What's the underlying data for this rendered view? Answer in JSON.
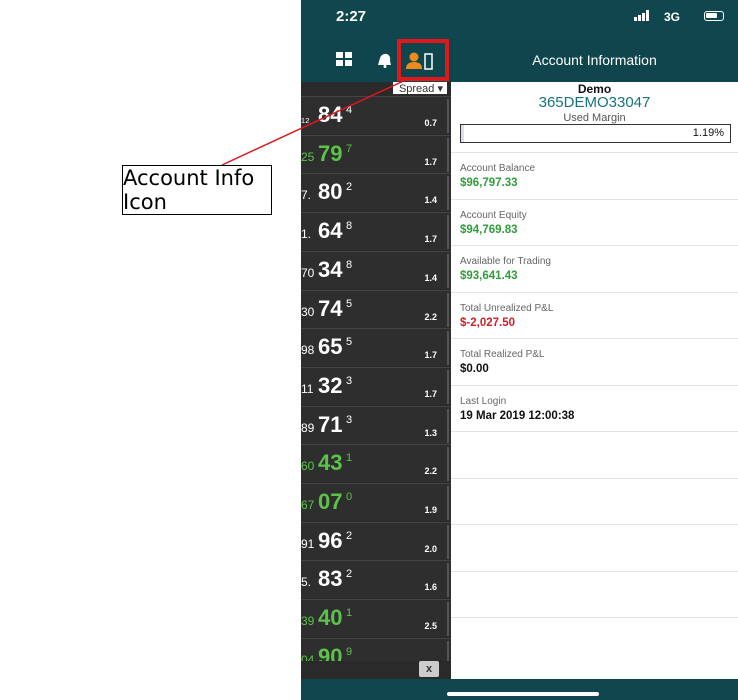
{
  "annotation": {
    "label": "Account Info Icon",
    "highlight_color": "#e0181c"
  },
  "status_bar": {
    "time": "2:27",
    "network": "3G"
  },
  "toolbar": {
    "grid_icon": "grid-icon",
    "alerts_icon": "bell-icon",
    "account_icon": "account-info-icon"
  },
  "header": {
    "title": "Account Information"
  },
  "prices": {
    "spread_label": "Spread ▾",
    "rows": [
      {
        "prefix": "₁₂",
        "main": "84",
        "sup": "4",
        "spread": "0.7",
        "color": "#ffffff"
      },
      {
        "prefix": "25",
        "main": "79",
        "sup": "7",
        "spread": "1.7",
        "color": "#5cc24a"
      },
      {
        "prefix": "7.",
        "main": "80",
        "sup": "2",
        "spread": "1.4",
        "color": "#ffffff"
      },
      {
        "prefix": "1.",
        "main": "64",
        "sup": "8",
        "spread": "1.7",
        "color": "#ffffff"
      },
      {
        "prefix": "70",
        "main": "34",
        "sup": "8",
        "spread": "1.4",
        "color": "#ffffff"
      },
      {
        "prefix": "30",
        "main": "74",
        "sup": "5",
        "spread": "2.2",
        "color": "#ffffff"
      },
      {
        "prefix": "98",
        "main": "65",
        "sup": "5",
        "spread": "1.7",
        "color": "#ffffff"
      },
      {
        "prefix": "11",
        "main": "32",
        "sup": "3",
        "spread": "1.7",
        "color": "#ffffff"
      },
      {
        "prefix": "89",
        "main": "71",
        "sup": "3",
        "spread": "1.3",
        "color": "#ffffff"
      },
      {
        "prefix": "60",
        "main": "43",
        "sup": "1",
        "spread": "2.2",
        "color": "#5cc24a"
      },
      {
        "prefix": "67",
        "main": "07",
        "sup": "0",
        "spread": "1.9",
        "color": "#5cc24a"
      },
      {
        "prefix": "91",
        "main": "96",
        "sup": "2",
        "spread": "2.0",
        "color": "#ffffff"
      },
      {
        "prefix": "5.",
        "main": "83",
        "sup": "2",
        "spread": "1.6",
        "color": "#ffffff"
      },
      {
        "prefix": "39",
        "main": "40",
        "sup": "1",
        "spread": "2.5",
        "color": "#5cc24a"
      },
      {
        "prefix": "04",
        "main": "90",
        "sup": "9",
        "spread": "",
        "color": "#5cc24a"
      }
    ],
    "close_label": "x"
  },
  "account": {
    "name": "Demo",
    "id": "365DEMO33047",
    "used_margin_label": "Used Margin",
    "used_margin_value": "1.19%",
    "used_margin_fraction": 0.0119,
    "fields": [
      {
        "label": "Account Balance",
        "value": "$96,797.33",
        "color": "#2f9e3a"
      },
      {
        "label": "Account Equity",
        "value": "$94,769.83",
        "color": "#2f9e3a"
      },
      {
        "label": "Available for Trading",
        "value": "$93,641.43",
        "color": "#2f9e3a"
      },
      {
        "label": "Total Unrealized P&L",
        "value": "$-2,027.50",
        "color": "#d0202a"
      },
      {
        "label": "Total Realized P&L",
        "value": "$0.00",
        "color": "#111111"
      },
      {
        "label": "Last Login",
        "value": "19 Mar 2019 12:00:38",
        "color": "#111111"
      }
    ]
  },
  "colors": {
    "header_bg": "#0f464e",
    "accent": "#16727c",
    "icon_active": "#f08a1c"
  }
}
